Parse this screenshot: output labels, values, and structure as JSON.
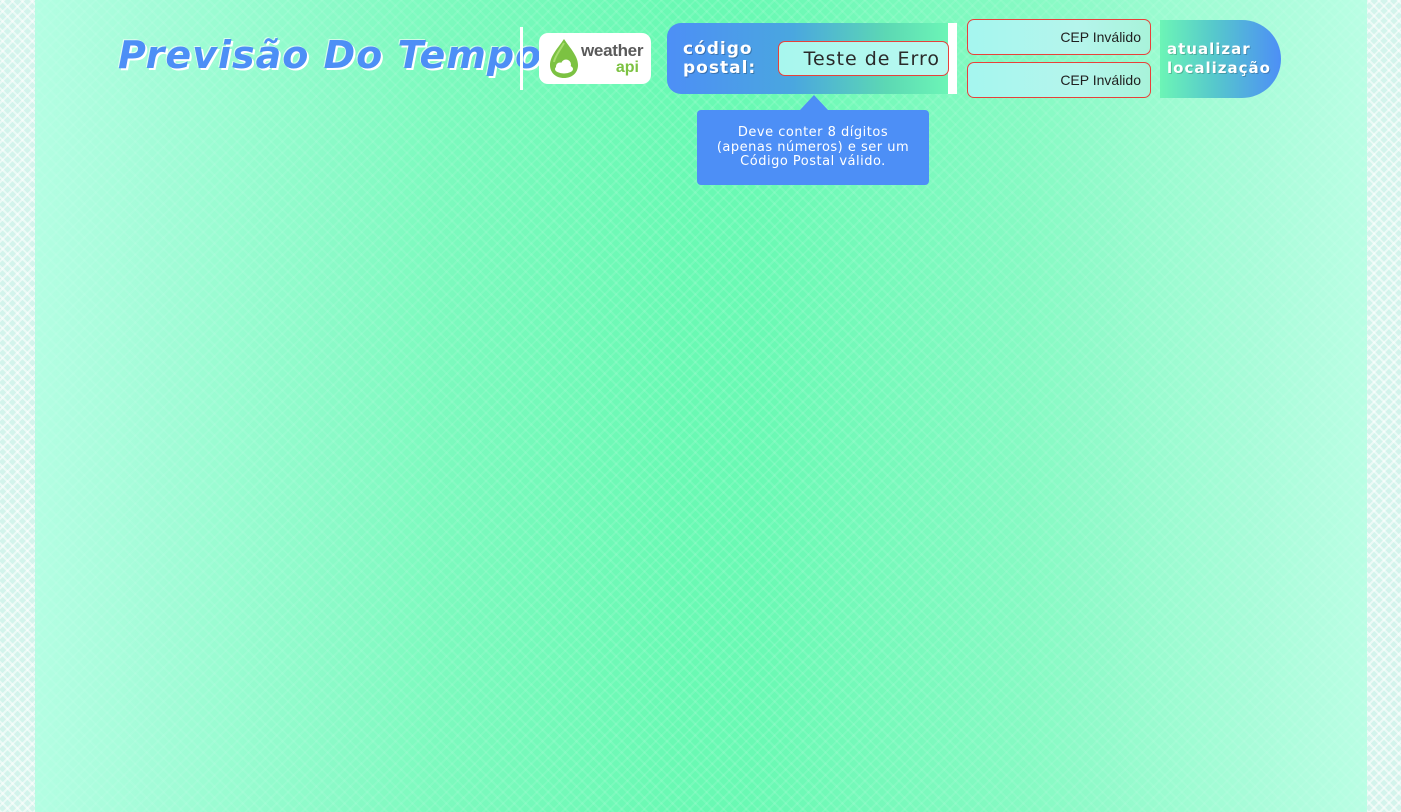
{
  "header": {
    "title": "Previsão Do Tempo",
    "logo": {
      "icon": "weather-drop-cloud-icon",
      "word": "weather",
      "sub": "api"
    }
  },
  "search": {
    "label": "código postal:",
    "input_value": "Teste de Erro",
    "tooltip": "Deve conter 8 dígitos (apenas números) e ser um Código Postal válido."
  },
  "cep_fields": [
    {
      "value": "CEP Inválido"
    },
    {
      "value": "CEP Inválido"
    }
  ],
  "update_button": {
    "label": "atualizar localização"
  },
  "colors": {
    "accent_blue": "#4d8ff6",
    "background_green": "#69f9b3",
    "error_red": "#e8403a",
    "logo_green": "#7cc242"
  }
}
